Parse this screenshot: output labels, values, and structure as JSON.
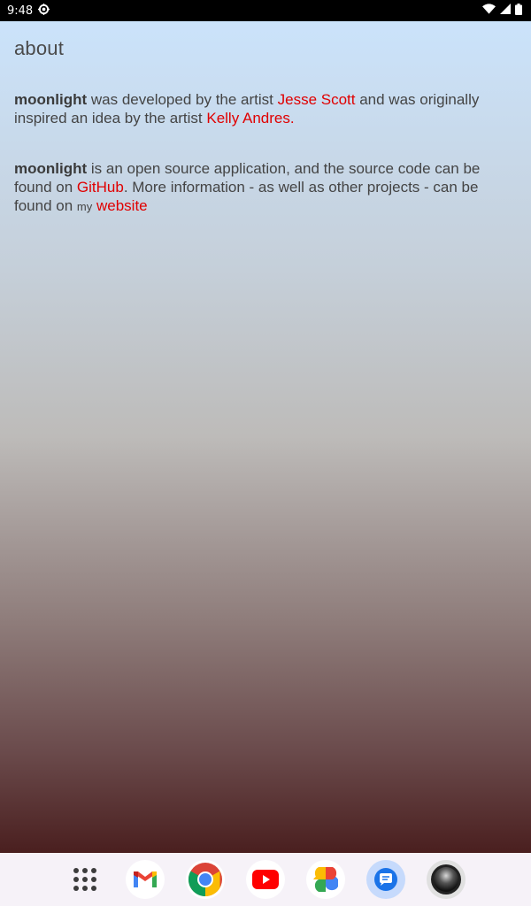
{
  "status_bar": {
    "time": "9:48"
  },
  "page": {
    "title": "about",
    "para1": {
      "app_name": "moonlight",
      "text_a": " was developed by the artist ",
      "link_artist": "Jesse Scott",
      "text_b": " and was originally inspired an idea by the artist ",
      "link_inspiration": "Kelly Andres",
      "text_c": "."
    },
    "para2": {
      "app_name": "moonlight",
      "text_a": " is an open source application, and the source code can be found on ",
      "link_github": "GitHub",
      "text_b": ". More information - as well as other projects - can be found on ",
      "small_my": "my",
      "text_c": " ",
      "link_website": "website"
    }
  },
  "colors": {
    "link": "#e00000",
    "gradient_top": "#cbe3fb",
    "gradient_bottom": "#4a1f1f"
  },
  "dock": {
    "apps": [
      "app-drawer-icon",
      "gmail-icon",
      "chrome-icon",
      "youtube-icon",
      "photos-icon",
      "messages-icon",
      "camera-icon"
    ]
  }
}
